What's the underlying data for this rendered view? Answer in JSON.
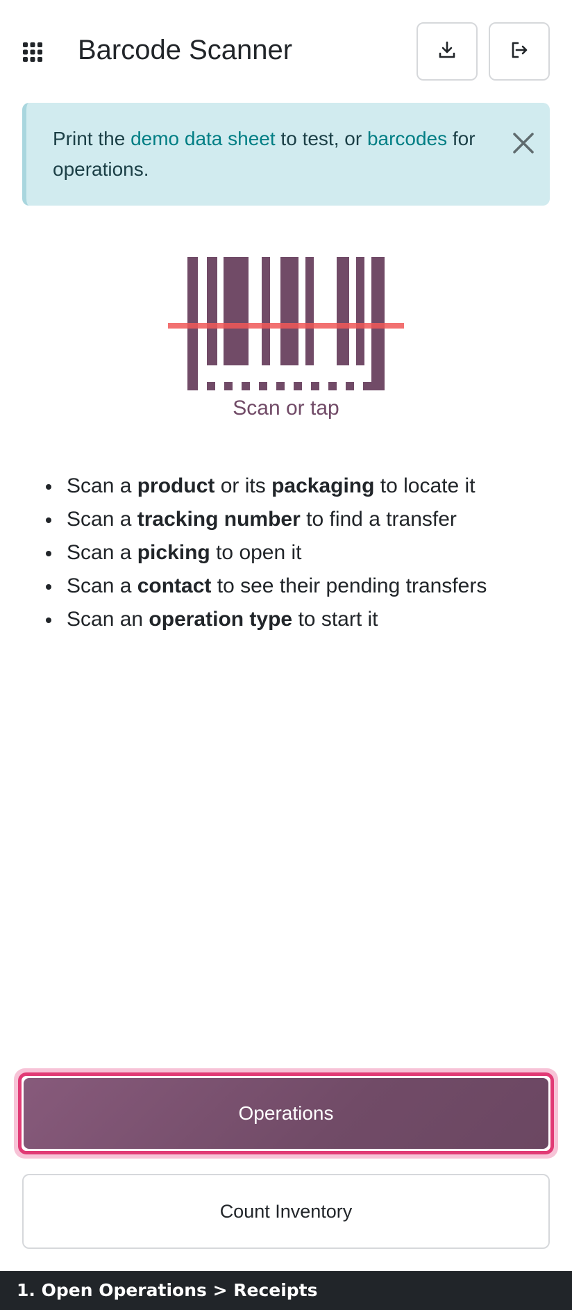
{
  "header": {
    "title": "Barcode Scanner",
    "apps_icon": "apps-grid-icon",
    "download_icon": "download-icon",
    "logout_icon": "logout-icon"
  },
  "alert": {
    "text_before": "Print the ",
    "link_demo": "demo data sheet",
    "text_middle": " to test, or ",
    "link_barcodes": "barcodes",
    "text_after": " for operations.",
    "close_icon": "close-icon",
    "background": "#d1ebef",
    "link_color": "#017e84"
  },
  "scanner": {
    "label": "Scan or tap",
    "icon": "barcode-icon",
    "brand_color": "#714b67",
    "laser_color": "#f05858"
  },
  "hints": [
    {
      "pre": "Scan a ",
      "b1": "product",
      "mid": " or its ",
      "b2": "packaging",
      "post": " to locate it"
    },
    {
      "pre": "Scan a ",
      "b1": "tracking number",
      "post": " to find a transfer"
    },
    {
      "pre": "Scan a ",
      "b1": "picking",
      "post": " to open it"
    },
    {
      "pre": "Scan a ",
      "b1": "contact",
      "post": " to see their pending transfers"
    },
    {
      "pre": "Scan an ",
      "b1": "operation type",
      "post": " to start it"
    }
  ],
  "buttons": {
    "operations": "Operations",
    "count_inventory": "Count Inventory",
    "highlight_color": "#e13a75"
  },
  "tour": {
    "step_text": "1. Open Operations > Receipts"
  }
}
